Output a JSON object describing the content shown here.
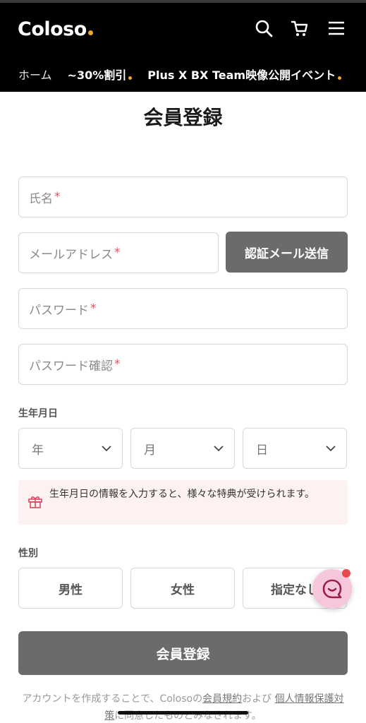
{
  "header": {
    "logo": "Coloso",
    "icons": [
      "search-icon",
      "cart-icon",
      "menu-icon"
    ],
    "nav": [
      "ホーム",
      "~30%割引",
      "Plus X BX Team映像公開イベント"
    ]
  },
  "form": {
    "title": "会員登録",
    "name_placeholder": "氏名",
    "email_placeholder": "メールアドレス",
    "verify_button": "認証メール送信",
    "password_placeholder": "パスワード",
    "password_confirm_placeholder": "パスワード確認",
    "required_mark": "*",
    "birth_label": "生年月日",
    "year": "年",
    "month": "月",
    "day": "日",
    "notice": "生年月日の情報を入力すると、様々な特典が受けられます。",
    "gender_label": "性別",
    "gender_male": "男性",
    "gender_female": "女性",
    "gender_unspecified": "指定なし",
    "submit": "会員登録"
  },
  "terms": {
    "prefix": "アカウントを作成することで、Colosoの",
    "link1": "会員規約",
    "mid": "および ",
    "link2": "個人情報保護対策",
    "suffix": "に同意したものとみなされます。"
  },
  "colors": {
    "accent": "#f5a623",
    "button": "#6b6b6b",
    "required": "#e25563",
    "notice_bg": "#fdf1f1"
  }
}
